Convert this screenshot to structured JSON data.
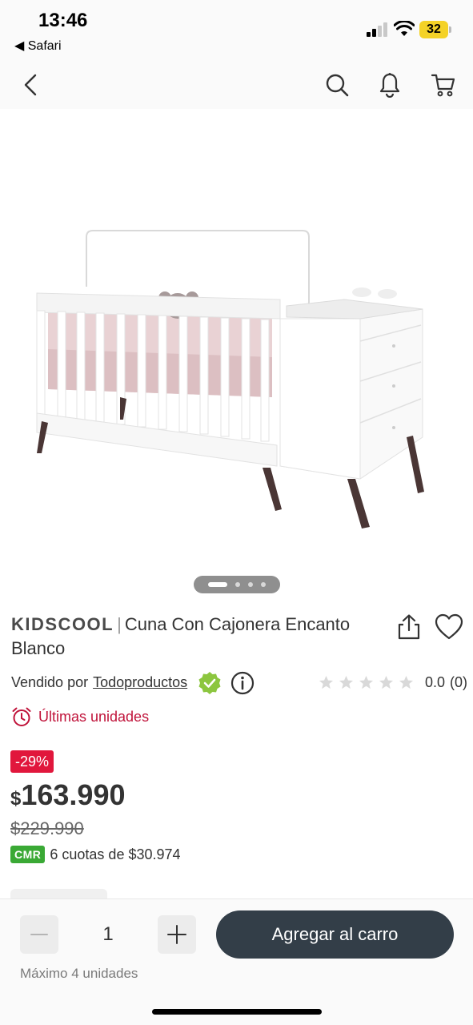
{
  "status_bar": {
    "time": "13:46",
    "back_app": "◀ Safari",
    "battery": "32",
    "battery_color": "#f4d227"
  },
  "nav": {
    "back_icon": "chevron-left-icon",
    "search_icon": "search-icon",
    "notifications_icon": "bell-icon",
    "cart_icon": "cart-icon"
  },
  "gallery": {
    "image_alt": "crib-with-drawers-image",
    "slide_count": 4,
    "active_slide": 1
  },
  "product": {
    "brand": "KIDSCOOL",
    "separator": "|",
    "name": "Cuna Con Cajonera Encanto Blanco",
    "seller_prefix": "Vendido por",
    "seller_name": "Todoproductos",
    "rating_value": "0.0",
    "rating_count": "(0)",
    "stars_filled": 0,
    "stars_total": 5,
    "stock_message": "Últimas unidades",
    "discount": "-29%",
    "currency": "$",
    "price": "163.990",
    "old_price_currency": "$",
    "old_price": "229.990",
    "cmr_badge": "CMR",
    "installments": "6 cuotas de $30.974"
  },
  "purchase": {
    "quantity": "1",
    "add_to_cart": "Agregar al carro",
    "max_units": "Máximo 4 unidades"
  },
  "colors": {
    "accent_dark": "#333e48",
    "discount_red": "#e1173c",
    "stock_red": "#c0133a",
    "cmr_green": "#3aa935",
    "verified_green": "#8cc63f"
  }
}
